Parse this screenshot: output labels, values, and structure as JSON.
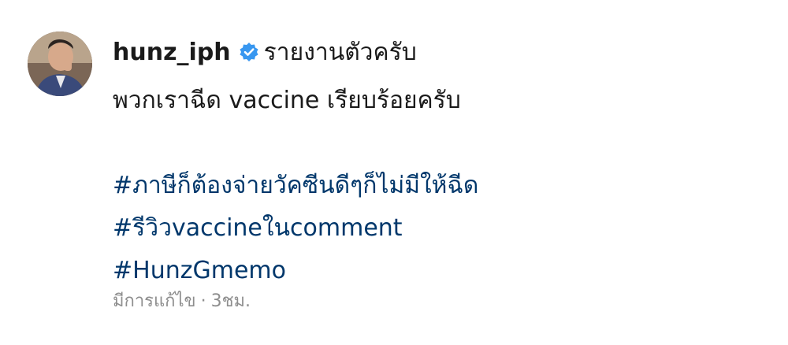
{
  "post": {
    "username": "hunz_iph",
    "verified_icon": "verified-badge-icon",
    "caption_line1": "รายงานตัวครับ",
    "caption_line2": "พวกเราฉีด vaccine เรียบร้อยครับ",
    "hashtags": [
      "#ภาษีก็ต้องจ่ายวัคซีนดีๆก็ไม่มีให้ฉีด",
      "#รีวิวvaccineในcomment",
      "#HunzGmemo"
    ],
    "edited_label": "มีการแก้ไข",
    "separator": "·",
    "time_ago": "3ชม."
  },
  "colors": {
    "text": "#1a1a1a",
    "hashtag": "#00376b",
    "meta": "#8e8e8e",
    "verified": "#3897f0"
  }
}
